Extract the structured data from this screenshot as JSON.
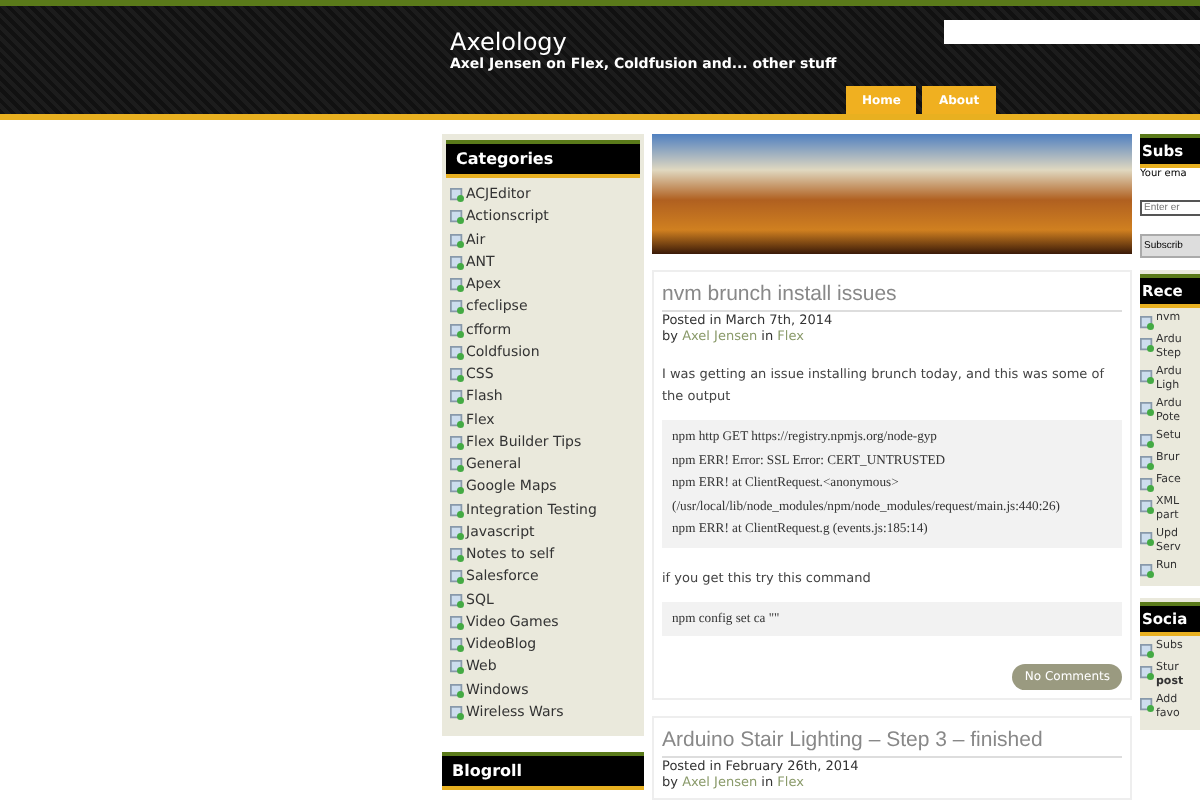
{
  "header": {
    "title": "Axelology",
    "tagline": "Axel Jensen on Flex, Coldfusion and... other stuff",
    "nav": [
      {
        "label": "Home",
        "selected": false
      },
      {
        "label": "About",
        "selected": false
      }
    ]
  },
  "categories": {
    "title": "Categories",
    "items": [
      "ACJEditor",
      "Actionscript",
      "Air",
      "ANT",
      "Apex",
      "cfeclipse",
      "cfform",
      "Coldfusion",
      "CSS",
      "Flash",
      "Flex",
      "Flex Builder Tips",
      "General",
      "Google Maps",
      "Integration Testing",
      "Javascript",
      "Notes to self",
      "Salesforce",
      "SQL",
      "Video Games",
      "VideoBlog",
      "Web",
      "Windows",
      "Wireless Wars"
    ]
  },
  "blogroll": {
    "title": "Blogroll"
  },
  "posts": [
    {
      "title": "nvm brunch install issues",
      "posted": "Posted in March 7th, 2014",
      "by": "by",
      "author": "Axel Jensen",
      "in": "in",
      "category": "Flex",
      "body": [
        {
          "kind": "text",
          "text": "I was getting an issue installing brunch today, and this was some of the output"
        },
        {
          "kind": "code",
          "lines": [
            "npm http GET https://registry.npmjs.org/node-gyp",
            "npm ERR! Error: SSL Error: CERT_UNTRUSTED",
            "npm ERR! at ClientRequest.<anonymous>",
            "(/usr/local/lib/node_modules/npm/node_modules/request/main.js:440:26)",
            "npm ERR! at ClientRequest.g (events.js:185:14)"
          ]
        },
        {
          "kind": "text",
          "text": "if you get this try this command"
        },
        {
          "kind": "code",
          "lines": [
            "npm config set ca \"\""
          ]
        }
      ],
      "comments": "No Comments"
    },
    {
      "title": "Arduino Stair Lighting – Step 3 – finished",
      "posted": "Posted in February 26th, 2014",
      "by": "by",
      "author": "Axel Jensen",
      "in": "in",
      "category": "Flex"
    }
  ],
  "right": {
    "subscribe_title": "Subs",
    "email_label": "Your ema",
    "email_placeholder": "Enter er",
    "subscribe_button": "Subscrib",
    "recent_title": "Rece",
    "recent": [
      [
        "nvm"
      ],
      [
        "Ardu",
        "Step"
      ],
      [
        "Ardu",
        "Ligh"
      ],
      [
        "Ardu",
        "Pote"
      ],
      [
        "Setu"
      ],
      [
        "Brur"
      ],
      [
        "Face"
      ],
      [
        "XML",
        "part"
      ],
      [
        "Upd",
        "Serv"
      ],
      [
        "Run"
      ]
    ],
    "social_title": "Socia",
    "social": [
      [
        "Subs"
      ],
      [
        "Stur",
        "**post**"
      ],
      [
        "Add",
        "favo"
      ]
    ]
  }
}
